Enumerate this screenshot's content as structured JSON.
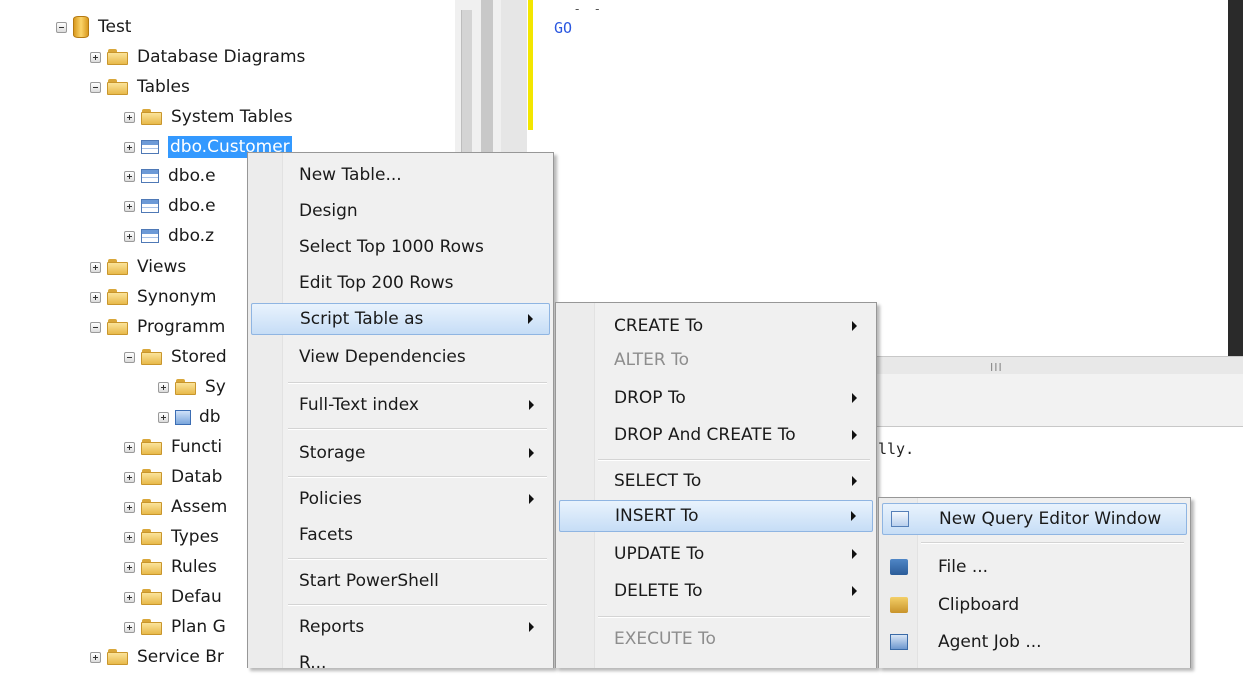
{
  "tree": {
    "database": "Test",
    "items": [
      {
        "label": "Database Diagrams"
      },
      {
        "label": "Tables"
      },
      {
        "label": "System Tables"
      },
      {
        "label": "dbo.Customer"
      },
      {
        "label": "dbo.e"
      },
      {
        "label": "dbo.e"
      },
      {
        "label": "dbo.z"
      },
      {
        "label": "Views"
      },
      {
        "label": "Synonym"
      },
      {
        "label": "Programm"
      },
      {
        "label": "Stored"
      },
      {
        "label": "Sy"
      },
      {
        "label": "db"
      },
      {
        "label": "Functi"
      },
      {
        "label": "Datab"
      },
      {
        "label": "Assem"
      },
      {
        "label": "Types"
      },
      {
        "label": "Rules"
      },
      {
        "label": "Defau"
      },
      {
        "label": "Plan G"
      },
      {
        "label": "Service Br"
      }
    ]
  },
  "editor": {
    "go_keyword": "GO",
    "code_fragment": "- -",
    "message_fragment": "lly.",
    "scroll_grip": "III"
  },
  "context_menu": {
    "items": [
      {
        "label": "New Table..."
      },
      {
        "label": "Design"
      },
      {
        "label": "Select Top 1000 Rows"
      },
      {
        "label": "Edit Top 200 Rows"
      },
      {
        "label": "Script Table as"
      },
      {
        "label": "View Dependencies"
      },
      {
        "label": "Full-Text index"
      },
      {
        "label": "Storage"
      },
      {
        "label": "Policies"
      },
      {
        "label": "Facets"
      },
      {
        "label": "Start PowerShell"
      },
      {
        "label": "Reports"
      },
      {
        "label": "R..."
      }
    ]
  },
  "script_submenu": {
    "items": [
      {
        "label": "CREATE To"
      },
      {
        "label": "ALTER To"
      },
      {
        "label": "DROP To"
      },
      {
        "label": "DROP And CREATE To"
      },
      {
        "label": "SELECT To"
      },
      {
        "label": "INSERT To"
      },
      {
        "label": "UPDATE To"
      },
      {
        "label": "DELETE To"
      },
      {
        "label": "EXECUTE To"
      }
    ]
  },
  "insert_submenu": {
    "items": [
      {
        "label": "New Query Editor Window",
        "icon": "query-window-icon"
      },
      {
        "label": "File ...",
        "icon": "save-file-icon"
      },
      {
        "label": "Clipboard",
        "icon": "clipboard-icon"
      },
      {
        "label": "Agent Job ...",
        "icon": "agent-job-icon"
      }
    ]
  },
  "colors": {
    "selection": "#3399ff",
    "menu_highlight": "#c6ddf6",
    "menu_background": "#f0f0f0",
    "go_keyword": "#2a57e0",
    "editor_margin": "#f3e600"
  }
}
